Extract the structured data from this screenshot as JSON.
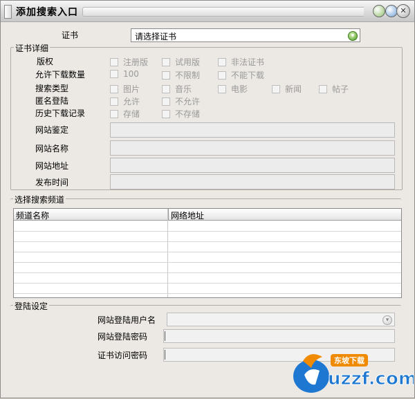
{
  "window": {
    "title": "添加搜索入口"
  },
  "certificate": {
    "label": "证书",
    "selected": "请选择证书"
  },
  "details": {
    "group_title": "证书详细",
    "rows": [
      {
        "label": "版权",
        "options": [
          "注册版",
          "试用版",
          "非法证书"
        ]
      },
      {
        "label": "允许下载数量",
        "options": [
          "100",
          "不限制",
          "不能下载"
        ]
      },
      {
        "label": "搜索类型",
        "options": [
          "图片",
          "音乐",
          "电影",
          "新闻",
          "帖子"
        ]
      },
      {
        "label": "匿名登陆",
        "options": [
          "允许",
          "不允许"
        ]
      },
      {
        "label": "历史下载记录",
        "options": [
          "存储",
          "不存储"
        ]
      }
    ],
    "fields": [
      {
        "label": "网站鉴定",
        "value": ""
      },
      {
        "label": "网站名称",
        "value": ""
      },
      {
        "label": "网站地址",
        "value": ""
      },
      {
        "label": "发布时间",
        "value": ""
      }
    ]
  },
  "channels": {
    "group_title": "选择搜索频道",
    "columns": [
      "频道名称",
      "网络地址"
    ]
  },
  "login": {
    "group_title": "登陆设定",
    "username_label": "网站登陆用户名",
    "password_label": "网站登陆密码",
    "cert_password_label": "证书访问密码"
  },
  "watermark": {
    "brand": "uzzf.com",
    "tagline": "东坡下载"
  },
  "colors": {
    "accent_green": "#4d9b21",
    "watermark_blue": "#1e78d2",
    "watermark_orange": "#f08a00"
  }
}
